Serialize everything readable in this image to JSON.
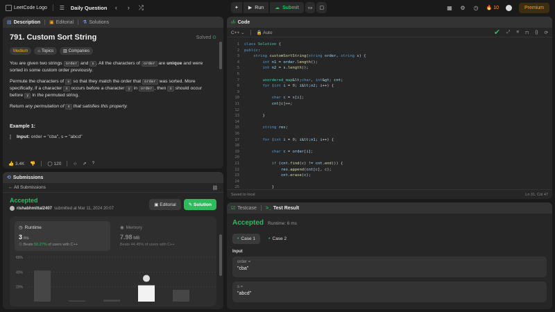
{
  "topbar": {
    "logo_text": "LeetCode Logo",
    "title": "Daily Question",
    "run_label": "Run",
    "submit_label": "Submit",
    "streak": "10",
    "premium_label": "Premium"
  },
  "desc_panel": {
    "tabs": [
      "Description",
      "Editorial",
      "Solutions"
    ],
    "title": "791. Custom Sort String",
    "solved_label": "Solved",
    "chips": [
      "Medium",
      "Topics",
      "Companies"
    ],
    "p1_a": "You are given two strings ",
    "p1_code1": "order",
    "p1_b": " and ",
    "p1_code2": "s",
    "p1_c": ". All the characters of ",
    "p1_code3": "order",
    "p1_d": " are ",
    "p1_bold": "unique",
    "p1_e": " and were sorted in some custom order previously.",
    "p2_a": "Permute the characters of ",
    "p2_code1": "s",
    "p2_b": " so that they match the order that ",
    "p2_code2": "order",
    "p2_c": " was sorted. More specifically, if a character ",
    "p2_code3": "x",
    "p2_d": " occurs before a character ",
    "p2_code4": "y",
    "p2_e": " in ",
    "p2_code5": "order",
    "p2_f": ", then ",
    "p2_code6": "x",
    "p2_g": " should occur before ",
    "p2_code7": "y",
    "p2_h": " in the permuted string.",
    "p3_a": "Return ",
    "p3_i": "any permutation of ",
    "p3_code": "s",
    "p3_i2": " that satisfies this property.",
    "example_title": "Example 1:",
    "example_input_label": "Input:",
    "example_input": " order = \"cba\", s = \"abcd\"",
    "likes": "3.4K",
    "comments": "120"
  },
  "sub_panel": {
    "title": "Submissions",
    "back_label": "All Submissions",
    "status": "Accepted",
    "user": "rishabhmittal2407",
    "submitted_text": " submitted at Mar 11, 2024 20:07",
    "editorial_label": "Editorial",
    "solution_label": "Solution",
    "runtime_label": "Runtime",
    "runtime_value": "3",
    "runtime_unit": " ms",
    "runtime_beats_a": "Beats ",
    "runtime_beats_pct": "50.27%",
    "runtime_beats_b": " of users with C++",
    "memory_label": "Memory",
    "memory_value": "7.98",
    "memory_unit": " MB",
    "memory_beats": "Beats 44.45% of users with C++"
  },
  "chart_data": {
    "type": "bar",
    "y_ticks": [
      "60%",
      "40%",
      "20%"
    ],
    "ylim": [
      0,
      60
    ],
    "values": [
      42,
      1.5,
      2.5,
      22,
      16
    ],
    "highlight_index": 3
  },
  "code_panel": {
    "title": "Code",
    "language": "C++",
    "mode": "Auto",
    "saved_label": "Saved to local",
    "cursor": "Ln 31, Col 47",
    "lines": [
      "class Solution {",
      "public:",
      "    string customSortString(string order, string s) {",
      "        int n1 = order.length();",
      "        int n2 = s.length();",
      "",
      "        unordered_map<char, int> cnt;",
      "        for (int i = 0; i<n2; i++) {",
      "",
      "            char c = s[i];",
      "            cnt[c]++;",
      "",
      "        }",
      "",
      "        string res;",
      "",
      "        for (int i = 0; i<n1; i++) {",
      "",
      "            char c = order[i];",
      "",
      "            if (cnt.find(c) != cnt.end()) {",
      "                res.append(cnt[c], c);",
      "                cnt.erase(c);",
      "",
      "            }"
    ]
  },
  "test_panel": {
    "tab1": "Testcase",
    "tab2": "Test Result",
    "status": "Accepted",
    "runtime": "Runtime: 6 ms",
    "cases": [
      "Case 1",
      "Case 2"
    ],
    "input_label": "Input",
    "inputs": [
      {
        "key": "order =",
        "value": "\"cba\""
      },
      {
        "key": "s =",
        "value": "\"abcd\""
      }
    ]
  },
  "colors": {
    "accent_green": "#2cbb5d",
    "accent_orange": "#ffa116",
    "bg": "#1a1a1a",
    "panel": "#262626"
  }
}
